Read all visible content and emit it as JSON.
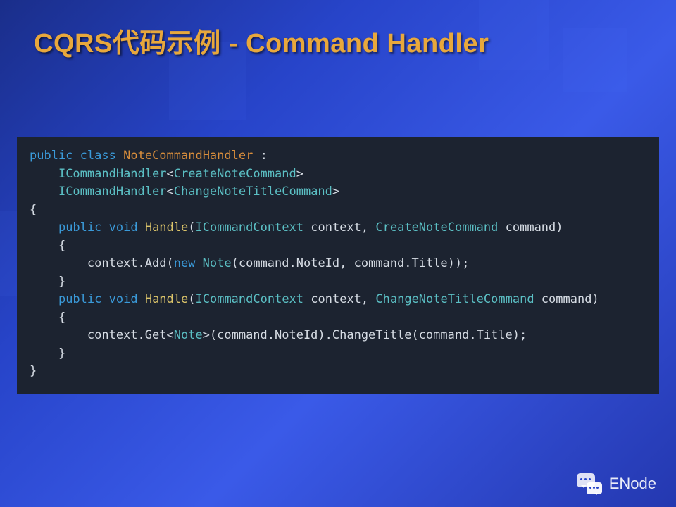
{
  "slide": {
    "title": "CQRS代码示例 - Command Handler"
  },
  "code": {
    "l1_kw1": "public",
    "l1_kw2": "class",
    "l1_cls": "NoteCommandHandler",
    "l1_colon": " :",
    "l2_type": "ICommandHandler",
    "l2_lt": "<",
    "l2_gen": "CreateNoteCommand",
    "l2_gt": ">",
    "l3_type": "ICommandHandler",
    "l3_lt": "<",
    "l3_gen": "ChangeNoteTitleCommand",
    "l3_gt": ">",
    "l4": "{",
    "l5_kw1": "public",
    "l5_kw2": "void",
    "l5_mth": "Handle",
    "l5_op": "(",
    "l5_t1": "ICommandContext",
    "l5_p1": " context, ",
    "l5_t2": "CreateNoteCommand",
    "l5_p2": " command)",
    "l6": "    {",
    "l7_a": "        context.Add(",
    "l7_kw": "new",
    "l7_b": " ",
    "l7_t": "Note",
    "l7_c": "(command.NoteId, command.Title));",
    "l8": "    }",
    "l9_kw1": "public",
    "l9_kw2": "void",
    "l9_mth": "Handle",
    "l9_op": "(",
    "l9_t1": "ICommandContext",
    "l9_p1": " context, ",
    "l9_t2": "ChangeNoteTitleCommand",
    "l9_p2": " command)",
    "l10": "    {",
    "l11_a": "        context.Get<",
    "l11_t": "Note",
    "l11_b": ">(command.NoteId).ChangeTitle(command.Title);",
    "l12": "    }",
    "l13": "}"
  },
  "footer": {
    "brand": "ENode"
  }
}
